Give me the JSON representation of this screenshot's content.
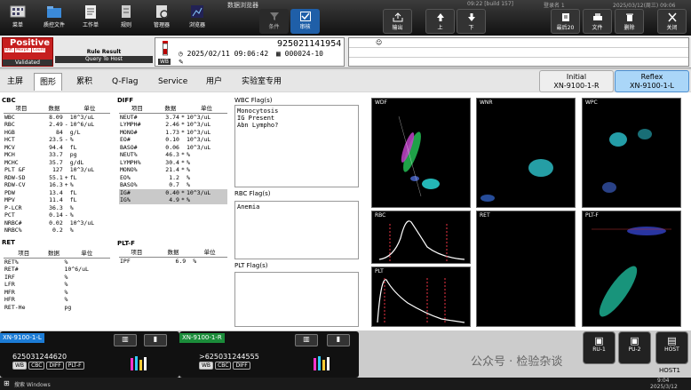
{
  "topbar": {
    "title": "数据浏览器",
    "build": "09:22 [build 157]",
    "login": "登录名 1",
    "datetime": "2025/03/12(周三) 09:06",
    "left_buttons": [
      "菜单",
      "质控文件",
      "工作单",
      "规则",
      "管理器",
      "浏览器"
    ],
    "mid_buttons": [
      "条件",
      "审核"
    ],
    "nav_buttons": [
      "输出",
      "上",
      "下"
    ],
    "right_buttons": [
      "最后20",
      "文件",
      "删除",
      "关闭"
    ]
  },
  "sample": {
    "status": "Positive",
    "tags": [
      "Diff.",
      "Morph.",
      "Count"
    ],
    "validated": "Validated",
    "rule_result": "Rule Result",
    "query_host": "Query To Host",
    "sample_no": "925021141954",
    "datetime": "2025/02/11 09:06:42",
    "rack": "000024-10",
    "mode": "WB"
  },
  "tabs": [
    "主屏",
    "图形",
    "累积",
    "Q-Flag",
    "Service",
    "用户",
    "实验室专用"
  ],
  "active_tab": "图形",
  "initial": {
    "title": "Initial",
    "id": "XN-9100-1-R"
  },
  "reflex": {
    "title": "Reflex",
    "id": "XN-9100-1-L"
  },
  "cbc": {
    "title": "CBC",
    "headers": [
      "项目",
      "数据",
      "单位"
    ],
    "rows": [
      [
        "WBC",
        "8.09",
        "",
        "10^3/uL"
      ],
      [
        "RBC",
        "2.49",
        "-",
        "10^6/uL"
      ],
      [
        "HGB",
        "84",
        "",
        "g/L"
      ],
      [
        "HCT",
        "23.5",
        "-",
        "%"
      ],
      [
        "MCV",
        "94.4",
        "",
        "fL"
      ],
      [
        "MCH",
        "33.7",
        "",
        "pg"
      ],
      [
        "MCHC",
        "35.7",
        "",
        "g/dL"
      ],
      [
        "PLT &F",
        "127",
        "",
        "10^3/uL"
      ],
      [
        "RDW-SD",
        "55.1",
        "+",
        "fL"
      ],
      [
        "RDW-CV",
        "16.3",
        "+",
        "%"
      ],
      [
        "PDW",
        "13.4",
        "",
        "fL"
      ],
      [
        "MPV",
        "11.4",
        "",
        "fL"
      ],
      [
        "P-LCR",
        "36.3",
        "",
        "%"
      ],
      [
        "PCT",
        "0.14",
        "-",
        "%"
      ],
      [
        "NRBC#",
        "0.02",
        "",
        "10^3/uL"
      ],
      [
        "NRBC%",
        "0.2",
        "",
        "%"
      ]
    ]
  },
  "ret": {
    "title": "RET",
    "headers": [
      "项目",
      "数据",
      "单位"
    ],
    "rows": [
      [
        "RET%",
        "",
        "",
        "%"
      ],
      [
        "RET#",
        "",
        "",
        "10^6/uL"
      ],
      [
        "IRF",
        "",
        "",
        "%"
      ],
      [
        "LFR",
        "",
        "",
        "%"
      ],
      [
        "MFR",
        "",
        "",
        "%"
      ],
      [
        "HFR",
        "",
        "",
        "%"
      ],
      [
        "RET-He",
        "",
        "",
        "pg"
      ]
    ]
  },
  "diff": {
    "title": "DIFF",
    "headers": [
      "项目",
      "数据",
      "单位"
    ],
    "rows": [
      [
        "NEUT#",
        "3.74",
        "*",
        "10^3/uL"
      ],
      [
        "LYMPH#",
        "2.46",
        "*",
        "10^3/uL"
      ],
      [
        "MONO#",
        "1.73",
        "*",
        "10^3/uL"
      ],
      [
        "EO#",
        "0.10",
        "",
        "10^3/uL"
      ],
      [
        "BASO#",
        "0.06",
        "",
        "10^3/uL"
      ],
      [
        "NEUT%",
        "46.3",
        "*",
        "%"
      ],
      [
        "LYMPH%",
        "30.4",
        "*",
        "%"
      ],
      [
        "MONO%",
        "21.4",
        "*",
        "%"
      ],
      [
        "EO%",
        "1.2",
        "",
        "%"
      ],
      [
        "BASO%",
        "0.7",
        "",
        "%"
      ],
      [
        "IG#",
        "0.40",
        "*",
        "10^3/uL"
      ],
      [
        "IG%",
        "4.9",
        "*",
        "%"
      ]
    ]
  },
  "pltf": {
    "title": "PLT-F",
    "headers": [
      "项目",
      "数据",
      "单位"
    ],
    "rows": [
      [
        "IPF",
        "6.9",
        "",
        "%"
      ]
    ]
  },
  "flags": {
    "wbc_title": "WBC Flag(s)",
    "wbc": "Monocytosis\nIG Present\nAbn Lympho?",
    "rbc_title": "RBC Flag(s)",
    "rbc": "Anemia",
    "plt_title": "PLT Flag(s)",
    "plt": ""
  },
  "graphs": [
    "WDF",
    "WNR",
    "WPC",
    "RBC",
    "RET",
    "PLT-F",
    "PLT"
  ],
  "bottom": {
    "card1": {
      "id": "XN-9100-1-L",
      "sample": "625031244620",
      "chips": [
        "WB",
        "CBC",
        "DIFF",
        "PLT-F"
      ]
    },
    "card2": {
      "id": "XN-9100-1-R",
      "sample": ">625031244555",
      "chips": [
        "WB",
        "CBC",
        "DIFF"
      ]
    },
    "rbtn": [
      "RU-1",
      "PU-2",
      "HOST",
      "HOST1"
    ],
    "watermark": "公众号 · 检验杂谈",
    "search": "搜索 Windows",
    "clock": "9:04",
    "date": "2025/3/12"
  }
}
